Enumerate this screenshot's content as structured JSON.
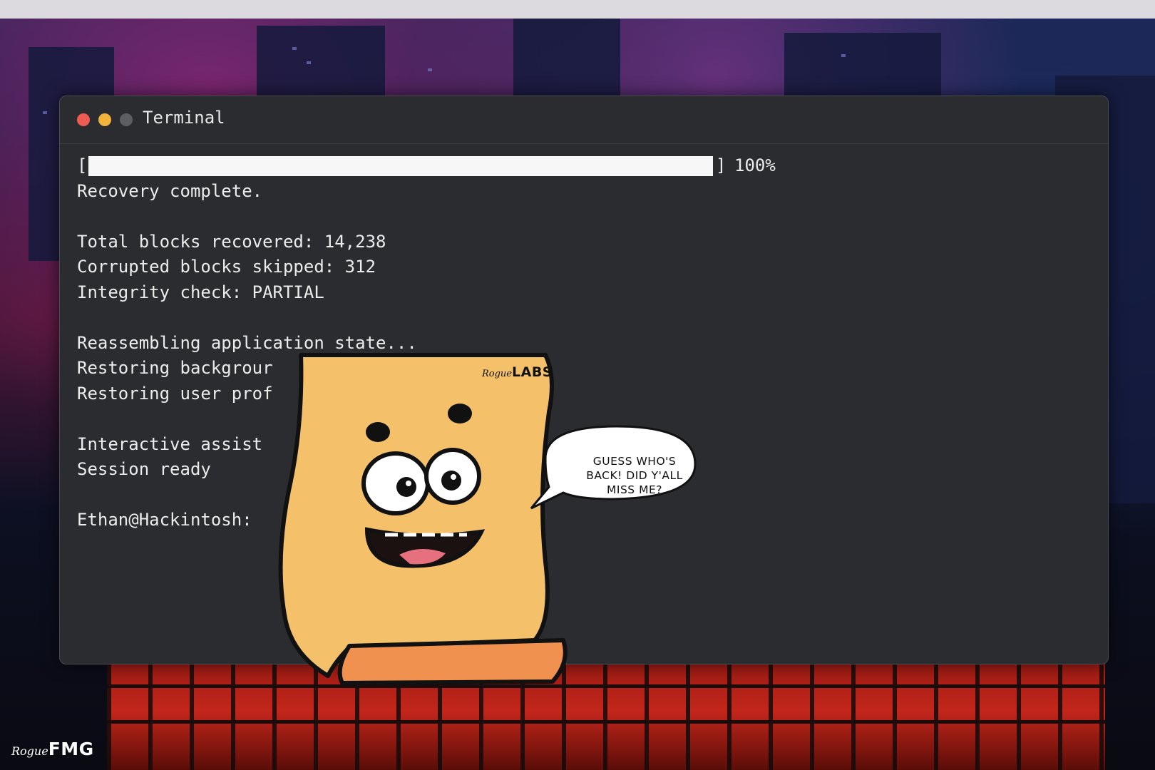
{
  "window": {
    "title": "Terminal",
    "controls": {
      "close_color": "#ee5b52",
      "minimize_color": "#f2b33a",
      "zoom_color": "#5c5e62"
    }
  },
  "terminal": {
    "progress": {
      "bracket_open": "[",
      "bracket_close": "]",
      "fill_fraction": 1.0,
      "percent_label": "100%"
    },
    "lines": {
      "recovery": "Recovery complete.",
      "total_blocks": "Total blocks recovered: 14,238",
      "corrupted_blocks": "Corrupted blocks skipped: 312",
      "integrity": "Integrity check: PARTIAL",
      "reassembling": "Reassembling application state...",
      "restoring_background": "Restoring backgrour",
      "restoring_profile": "Restoring user prof",
      "interactive": "Interactive assist",
      "session": "Session ready",
      "prompt": "Ethan@Hackintosh:"
    }
  },
  "mascot": {
    "speech_bubble": [
      "GUESS WHO'S",
      "BACK! DID Y'ALL",
      "MISS ME?"
    ],
    "logo_script": "Rogue",
    "logo_bold": "LABS",
    "scroll_color": "#f4c06a",
    "scroll_end_color": "#f1914f"
  },
  "watermark": {
    "script": "Rogue",
    "bold": "FMG"
  },
  "colors": {
    "terminal_bg": "#2a2c2f",
    "text": "#ececec",
    "backdrop_accent": "#c3261a"
  }
}
